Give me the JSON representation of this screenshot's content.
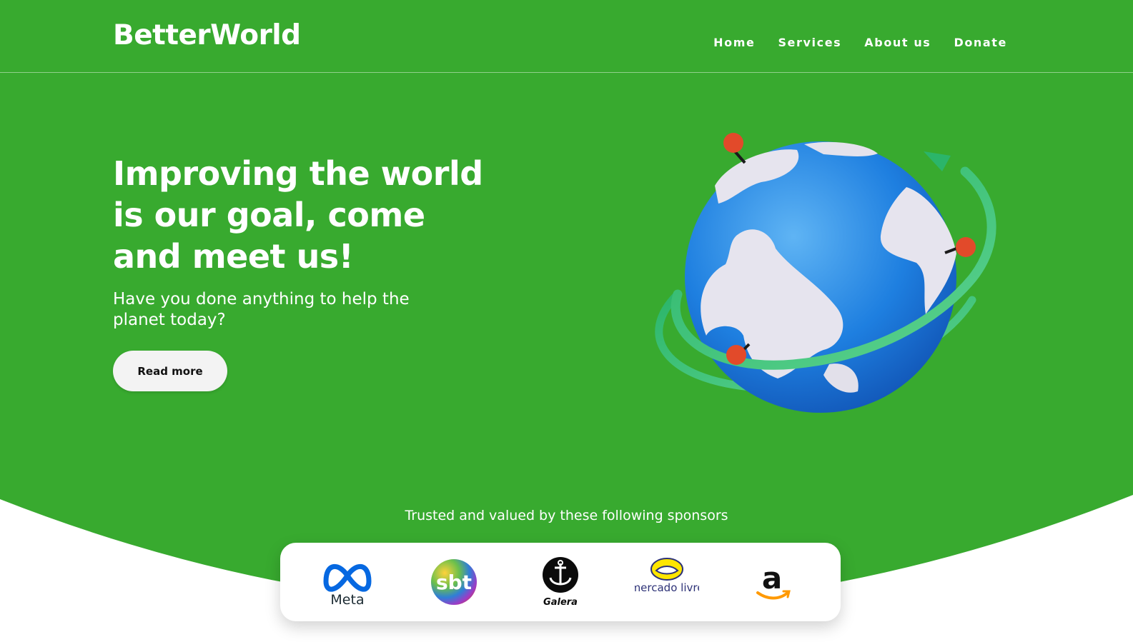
{
  "brand": {
    "name": "BetterWorld"
  },
  "nav": {
    "items": [
      {
        "label": "Home"
      },
      {
        "label": "Services"
      },
      {
        "label": "About us"
      },
      {
        "label": "Donate"
      }
    ]
  },
  "hero": {
    "headline": "Improving the world is our goal, come and meet us!",
    "subtext": "Have you done anything to help the planet today?",
    "cta_label": "Read more",
    "illustration_icon": "globe-with-orbit-arrow-icon"
  },
  "sponsors": {
    "caption": "Trusted and valued by these following sponsors",
    "logos": [
      {
        "text": "Meta",
        "icon": "meta-logo"
      },
      {
        "text": "sbt",
        "icon": "sbt-logo"
      },
      {
        "text": "Galera",
        "icon": "galera-anchor-logo"
      },
      {
        "text": "mercado livre",
        "icon": "mercado-livre-logo"
      },
      {
        "text": "a",
        "icon": "amazon-logo"
      }
    ]
  },
  "colors": {
    "brand_green": "#38aa2f",
    "white": "#ffffff",
    "button_bg": "#f3f3f3"
  }
}
